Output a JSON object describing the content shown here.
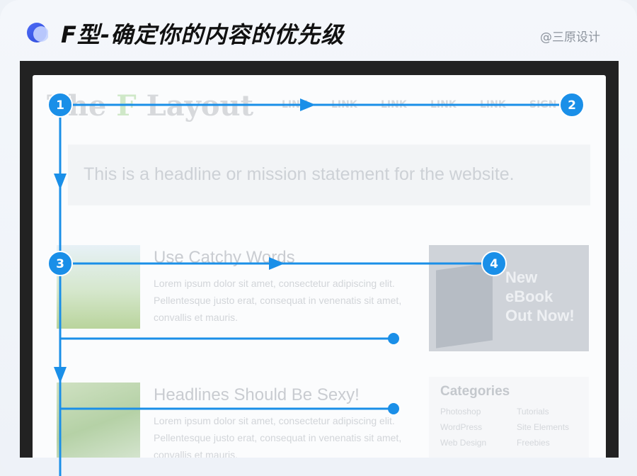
{
  "header": {
    "title": "F型-确定你的内容的优先级",
    "author": "@三原设计"
  },
  "site": {
    "logo_prefix": "The ",
    "logo_f": "F",
    "logo_suffix": " Layout",
    "nav": [
      "LINK",
      "LINK",
      "LINK",
      "LINK",
      "LINK",
      "SIGN"
    ],
    "headline": "This is a headline or mission statement for the website.",
    "articles": [
      {
        "title": "Use Catchy Words",
        "body": "Lorem ipsum dolor sit amet, consectetur adipiscing elit. Pellentesque justo erat, consequat in venenatis sit amet, convallis et mauris."
      },
      {
        "title": "Headlines Should Be Sexy!",
        "body": "Lorem ipsum dolor sit amet, consectetur adipiscing elit. Pellentesque justo erat, consequat in venenatis sit amet, convallis et mauris."
      }
    ],
    "ebook": "New eBook Out Now!",
    "categories": {
      "title": "Categories",
      "items": [
        "Photoshop",
        "Tutorials",
        "WordPress",
        "Site Elements",
        "Web Design",
        "Freebies"
      ]
    }
  },
  "markers": [
    "1",
    "2",
    "3",
    "4"
  ],
  "colors": {
    "accent": "#1a8fe8",
    "title_text": "#111111"
  }
}
